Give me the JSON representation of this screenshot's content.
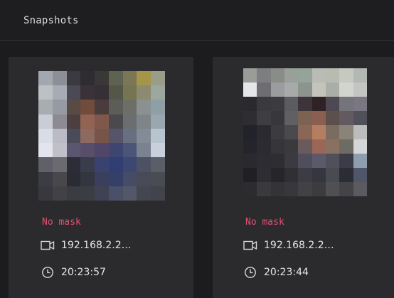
{
  "header": {
    "title": "Snapshots"
  },
  "snapshots": [
    {
      "status": "No mask",
      "ip": "192.168.2.2…",
      "time": "20:23:57",
      "pixels": [
        "#a3a8b0",
        "#8c8f98",
        "#3b3a40",
        "#2e2c30",
        "#3a3836",
        "#5e6250",
        "#7a7656",
        "#a49548",
        "#9a9e88",
        "#bcc2c4",
        "#a6abb4",
        "#4a4a55",
        "#3a3236",
        "#343036",
        "#555548",
        "#767552",
        "#8c8a70",
        "#9ca7a0",
        "#a8aeb0",
        "#959aa3",
        "#5a4a44",
        "#704c3c",
        "#4a3c3c",
        "#5c5c58",
        "#6d6e68",
        "#8a9190",
        "#8ea0a6",
        "#c8cdd6",
        "#8e8a94",
        "#4b3f40",
        "#926252",
        "#80584a",
        "#4a4a4e",
        "#6a6e70",
        "#7e8588",
        "#9aa7b0",
        "#d8dde6",
        "#b9bbc6",
        "#4b4a58",
        "#8c6a60",
        "#765448",
        "#55546a",
        "#667080",
        "#828c96",
        "#b8c4ce",
        "#e2e5ee",
        "#bfc0ca",
        "#5a5670",
        "#574e6a",
        "#50466a",
        "#3e4570",
        "#4a5578",
        "#7a8290",
        "#c9d0dc",
        "#5f6068",
        "#6a6a70",
        "#2c2d36",
        "#3a3c4c",
        "#3a4270",
        "#303e72",
        "#3c4772",
        "#4e5064",
        "#5b5e66",
        "#3c3d44",
        "#48484c",
        "#2a2c34",
        "#34363f",
        "#3a3f5c",
        "#354068",
        "#454c66",
        "#484a58",
        "#4a4c54",
        "#38393e",
        "#414146",
        "#3a3c42",
        "#3b3d44",
        "#3e4252",
        "#4a5068",
        "#535868",
        "#444650",
        "#42444c"
      ]
    },
    {
      "status": "No mask",
      "ip": "192.168.2.2…",
      "time": "20:23:44",
      "pixels": [
        "#9a9c98",
        "#7c7e80",
        "#8a8c88",
        "#98a098",
        "#94a498",
        "#b8bcb4",
        "#b8bcb0",
        "#c6c8c2",
        "#b4b8b4",
        "#e4e6e8",
        "#6e6e72",
        "#9a9ca0",
        "#a8aaaa",
        "#8c948e",
        "#c4c4bc",
        "#aaaea8",
        "#d2d4d0",
        "#c4c4c4",
        "#2a2a2e",
        "#3a3a3e",
        "#3c3c40",
        "#5a5c60",
        "#3c3438",
        "#2e2226",
        "#4e4852",
        "#75747a",
        "#7a7682",
        "#2e2e32",
        "#3e3e42",
        "#38383c",
        "#5e6064",
        "#7c6250",
        "#8a5e50",
        "#5c504c",
        "#625a60",
        "#505058",
        "#22222a",
        "#2a2a30",
        "#3c3c40",
        "#4a4a4e",
        "#8a6656",
        "#b67e60",
        "#7a6c60",
        "#8a8478",
        "#bcbcbc",
        "#24242a",
        "#2c2c30",
        "#363638",
        "#3a3a3e",
        "#6a5a5c",
        "#9a6658",
        "#8a7060",
        "#6c6c64",
        "#d4d6d8",
        "#2a2a2e",
        "#2c2c32",
        "#2e2e32",
        "#3a3a40",
        "#4e4e5c",
        "#5c5a6a",
        "#50505c",
        "#3c3c48",
        "#8e9eae",
        "#202024",
        "#2e2e32",
        "#262628",
        "#303034",
        "#3c3c44",
        "#363640",
        "#484c52",
        "#2c2c34",
        "#50566a",
        "#2c2c30",
        "#3a3a3e",
        "#343438",
        "#38383c",
        "#424246",
        "#3c3c40",
        "#505054",
        "#444448",
        "#5a5a60"
      ]
    }
  ]
}
